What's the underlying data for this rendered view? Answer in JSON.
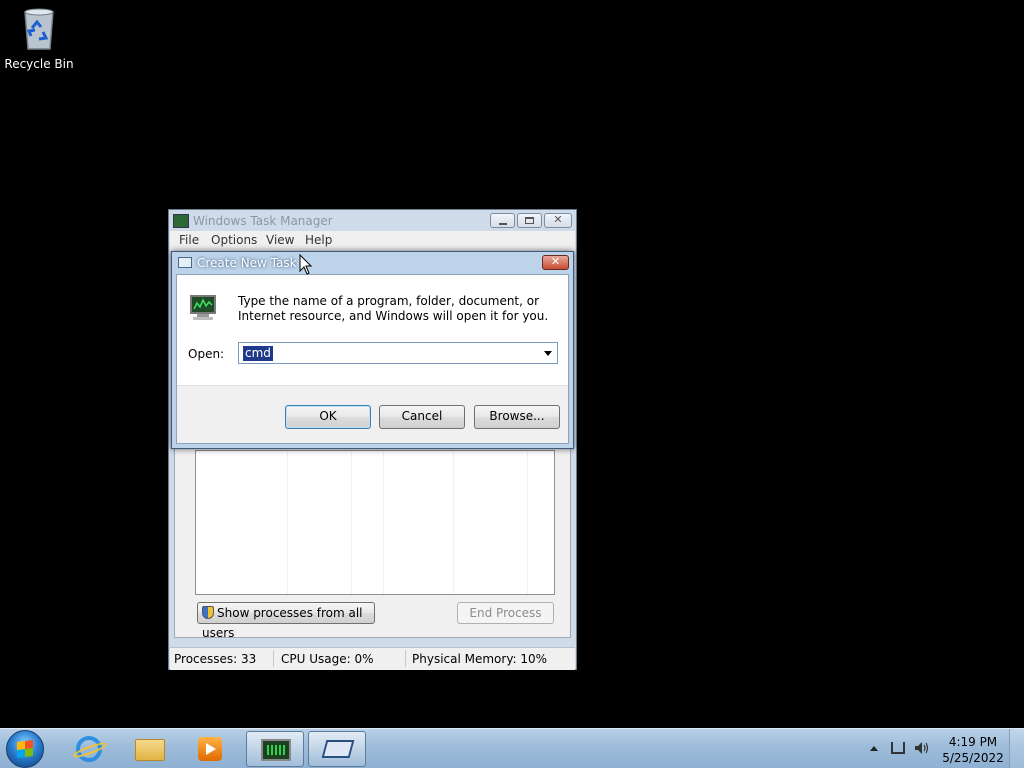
{
  "desktop": {
    "recycle_bin_label": "Recycle Bin"
  },
  "task_manager": {
    "title": "Windows Task Manager",
    "menu": [
      "File",
      "Options",
      "View",
      "Help"
    ],
    "show_processes_label": "Show processes from all users",
    "end_process_label": "End Process",
    "status": {
      "processes": "Processes: 33",
      "cpu": "CPU Usage: 0%",
      "memory": "Physical Memory: 10%"
    }
  },
  "run_dialog": {
    "title": "Create New Task",
    "description": "Type the name of a program, folder, document, or Internet resource, and Windows will open it for you.",
    "open_label": "Open:",
    "open_value": "cmd",
    "ok_label": "OK",
    "cancel_label": "Cancel",
    "browse_label": "Browse..."
  },
  "taskbar": {
    "pinned": [
      "internet-explorer-icon",
      "windows-explorer-icon",
      "media-player-icon",
      "task-manager-icon",
      "run-dialog-icon"
    ],
    "clock_time": "4:19 PM",
    "clock_date": "5/25/2022"
  }
}
